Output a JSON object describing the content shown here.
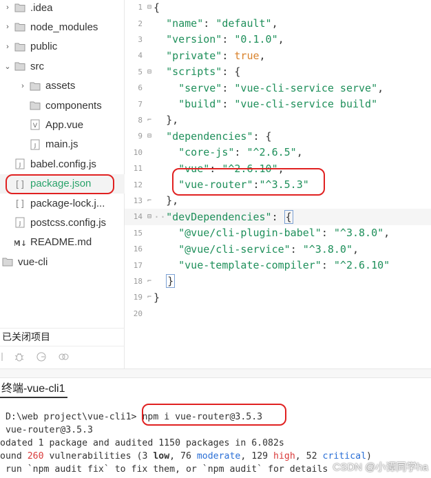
{
  "tree": [
    {
      "label": ".idea",
      "type": "folder",
      "indent": 0,
      "arrow": "›"
    },
    {
      "label": "node_modules",
      "type": "folder",
      "indent": 0,
      "arrow": "›"
    },
    {
      "label": "public",
      "type": "folder",
      "indent": 0,
      "arrow": "›"
    },
    {
      "label": "src",
      "type": "folder",
      "indent": 0,
      "arrow": "⌄"
    },
    {
      "label": "assets",
      "type": "folder",
      "indent": 1,
      "arrow": "›"
    },
    {
      "label": "components",
      "type": "folder",
      "indent": 1,
      "arrow": ""
    },
    {
      "label": "App.vue",
      "type": "vue",
      "indent": 1,
      "arrow": ""
    },
    {
      "label": "main.js",
      "type": "js",
      "indent": 1,
      "arrow": ""
    },
    {
      "label": "babel.config.js",
      "type": "js",
      "indent": 0,
      "arrow": ""
    },
    {
      "label": "package.json",
      "type": "json",
      "indent": 0,
      "arrow": "",
      "selected": true
    },
    {
      "label": "package-lock.j...",
      "type": "json",
      "indent": 0,
      "arrow": ""
    },
    {
      "label": "postcss.config.js",
      "type": "js",
      "indent": 0,
      "arrow": ""
    },
    {
      "label": "README.md",
      "type": "md",
      "indent": 0,
      "arrow": ""
    },
    {
      "label": "vue-cli",
      "type": "folder",
      "indent": -1,
      "arrow": ""
    }
  ],
  "sidebar": {
    "closed_projects": "已关闭项目"
  },
  "editor": {
    "lines": [
      {
        "n": "1",
        "fold": "⊟"
      },
      {
        "n": "2"
      },
      {
        "n": "3"
      },
      {
        "n": "4"
      },
      {
        "n": "5"
      },
      {
        "n": "6"
      },
      {
        "n": "7"
      },
      {
        "n": "8"
      },
      {
        "n": "9"
      },
      {
        "n": "10"
      },
      {
        "n": "11"
      },
      {
        "n": "12"
      },
      {
        "n": "13"
      },
      {
        "n": "14"
      },
      {
        "n": "15"
      },
      {
        "n": "16"
      },
      {
        "n": "17"
      },
      {
        "n": "18"
      },
      {
        "n": "19"
      },
      {
        "n": "20"
      }
    ]
  },
  "terminal": {
    "tab_title": "终端-vue-cli1",
    "prompt": " D:\\web project\\vue-cli1>",
    "command": " npm i vue-router@3.5.3",
    "line2": " vue-router@3.5.3",
    "line3": "odated 1 package and audited 1150 packages in 6.082s",
    "line4_a": "ound ",
    "line4_count": "260",
    "line4_b": " vulnerabilities (3 ",
    "line4_low": "low",
    "line4_c": ", 76 ",
    "line4_moderate": "moderate",
    "line4_d": ", 129 ",
    "line4_high": "high",
    "line4_e": ", 52 ",
    "line4_critical": "critical",
    "line4_f": ")",
    "line5": " run `npm audit fix` to fix them, or `npm audit` for details"
  },
  "watermark": "CSDN @小谭同学ha",
  "colors": {
    "accent_green": "#2aa36b",
    "annotation_red": "#e02020",
    "string_green": "#1e8f5a",
    "boolean_orange": "#d9822b"
  }
}
